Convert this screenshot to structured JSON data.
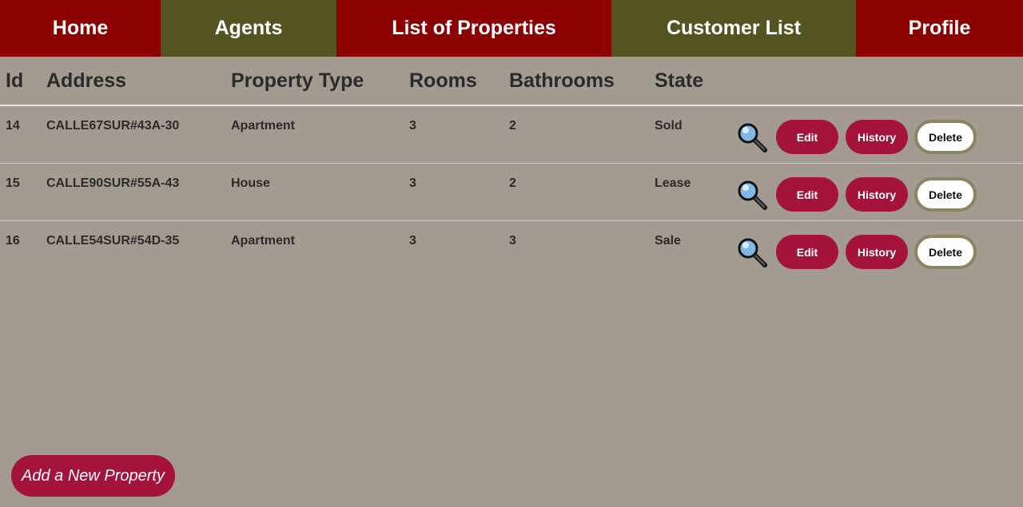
{
  "nav": {
    "home": "Home",
    "agents": "Agents",
    "properties": "List of Properties",
    "customers": "Customer List",
    "profile": "Profile"
  },
  "table": {
    "headers": {
      "id": "Id",
      "address": "Address",
      "type": "Property Type",
      "rooms": "Rooms",
      "bathrooms": "Bathrooms",
      "state": "State"
    },
    "rows": [
      {
        "id": "14",
        "address": "CALLE67SUR#43A-30",
        "type": "Apartment",
        "rooms": "3",
        "bathrooms": "2",
        "state": "Sold"
      },
      {
        "id": "15",
        "address": "CALLE90SUR#55A-43",
        "type": "House",
        "rooms": "3",
        "bathrooms": "2",
        "state": "Lease"
      },
      {
        "id": "16",
        "address": "CALLE54SUR#54D-35",
        "type": "Apartment",
        "rooms": "3",
        "bathrooms": "3",
        "state": "Sale"
      }
    ],
    "actions": {
      "view_icon": "magnifying-glass-icon",
      "edit": "Edit",
      "history": "History",
      "delete": "Delete"
    }
  },
  "add_property": "Add a New Property",
  "colors": {
    "nav_red": "#8b0000",
    "nav_olive": "#545423",
    "background": "#a39a91",
    "accent": "#a4133c",
    "delete_border": "#8c8460"
  }
}
